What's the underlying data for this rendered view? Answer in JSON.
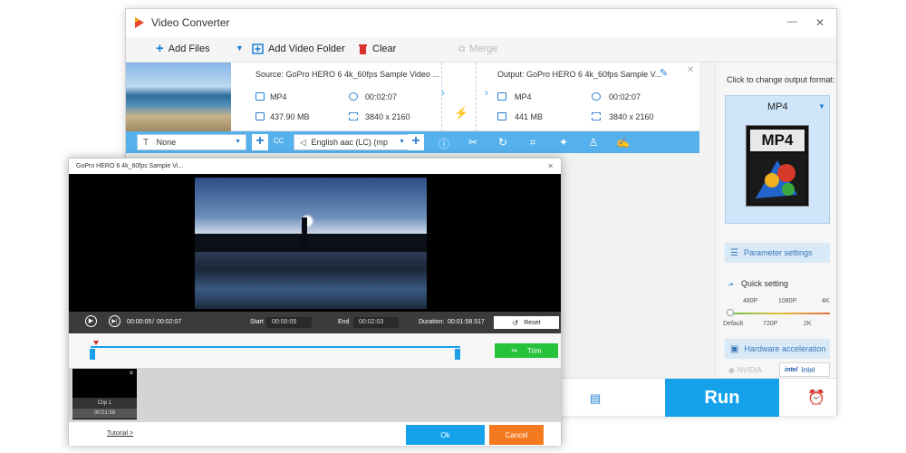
{
  "window": {
    "title": "Video Converter",
    "minimize": "—",
    "close": "✕"
  },
  "toolbar": {
    "add_files": "Add Files",
    "add_video_folder": "Add Video Folder",
    "clear": "Clear",
    "merge": "Merge"
  },
  "file": {
    "source": "Source: GoPro HERO 6 4k_60fps Sample  Video ...",
    "output": "Output: GoPro HERO 6 4k_60fps Sample  V...",
    "src_format": "MP4",
    "src_duration": "00:02:07",
    "src_size": "437.90 MB",
    "src_resolution": "3840 x 2160",
    "out_format": "MP4",
    "out_duration": "00:02:07",
    "out_size": "441 MB",
    "out_resolution": "3840 x 2160"
  },
  "action_bar": {
    "subtitle": "None",
    "audio_track": "English aac (LC) (mp"
  },
  "right_panel": {
    "output_format_label": "Click to change output format:",
    "format": "MP4",
    "format_tile": "MP4",
    "parameter_settings": "Parameter settings",
    "quick_setting": "Quick setting",
    "ticks_top": [
      "480P",
      "1080P",
      "4K"
    ],
    "ticks_bottom": [
      "Default",
      "720P",
      "2K"
    ],
    "hardware_acceleration": "Hardware acceleration",
    "nvidia": "NVIDIA",
    "intel": "Intel"
  },
  "run": "Run",
  "trim": {
    "title": "GoPro HERO 6 4k_60fps Sample  Vi...",
    "close": "✕",
    "current_time": "00:00:05",
    "total_time": "00:02:07",
    "time_separator": "/",
    "start_label": "Start",
    "start_value": "00:00:05",
    "end_label": "End",
    "end_value": "00:02:03",
    "duration_label": "Duration:",
    "duration_value": "00:01:58.517",
    "reset": "Reset",
    "trim_button": "Trim",
    "clip_name": "Clip 1",
    "clip_duration": "00:01:58",
    "tutorial": "Tutorial >",
    "ok": "Ok",
    "cancel": "Cancel"
  }
}
